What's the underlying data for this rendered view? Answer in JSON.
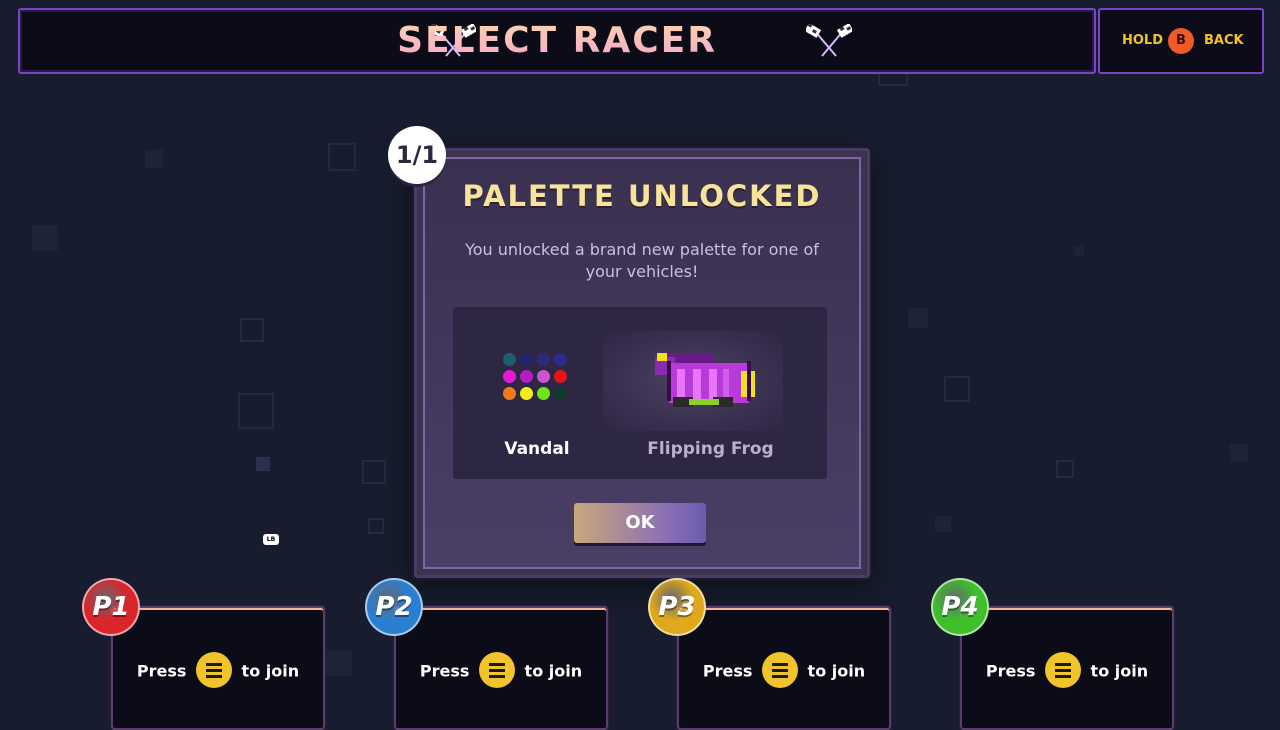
{
  "header": {
    "title": "SELECT RACER",
    "hold_label": "HOLD",
    "button_glyph": "B",
    "back_label": "BACK",
    "icons": [
      "checkered-flags-icon",
      "checkered-flags-icon"
    ]
  },
  "dialog": {
    "counter": "1/1",
    "title": "PALETTE UNLOCKED",
    "description": "You unlocked a brand new palette for one of your vehicles!",
    "palette_name": "Vandal",
    "vehicle_name": "Flipping Frog",
    "palette_colors": [
      "#1d5e6e",
      "#23246e",
      "#2c2b7a",
      "#2d2a8c",
      "#e31ad6",
      "#b51dc2",
      "#cc55d6",
      "#e5141c",
      "#ef7a1c",
      "#f4ec18",
      "#6fe41a",
      "#123a2a"
    ],
    "ok_label": "OK"
  },
  "lb_label": "LB",
  "players": [
    {
      "badge": "P1",
      "color": "#d9262b",
      "press": "Press",
      "join": "to join"
    },
    {
      "badge": "P2",
      "color": "#2a7fd0",
      "press": "Press",
      "join": "to join"
    },
    {
      "badge": "P3",
      "color": "#e0a81c",
      "press": "Press",
      "join": "to join"
    },
    {
      "badge": "P4",
      "color": "#3fbf2a",
      "press": "Press",
      "join": "to join"
    }
  ]
}
